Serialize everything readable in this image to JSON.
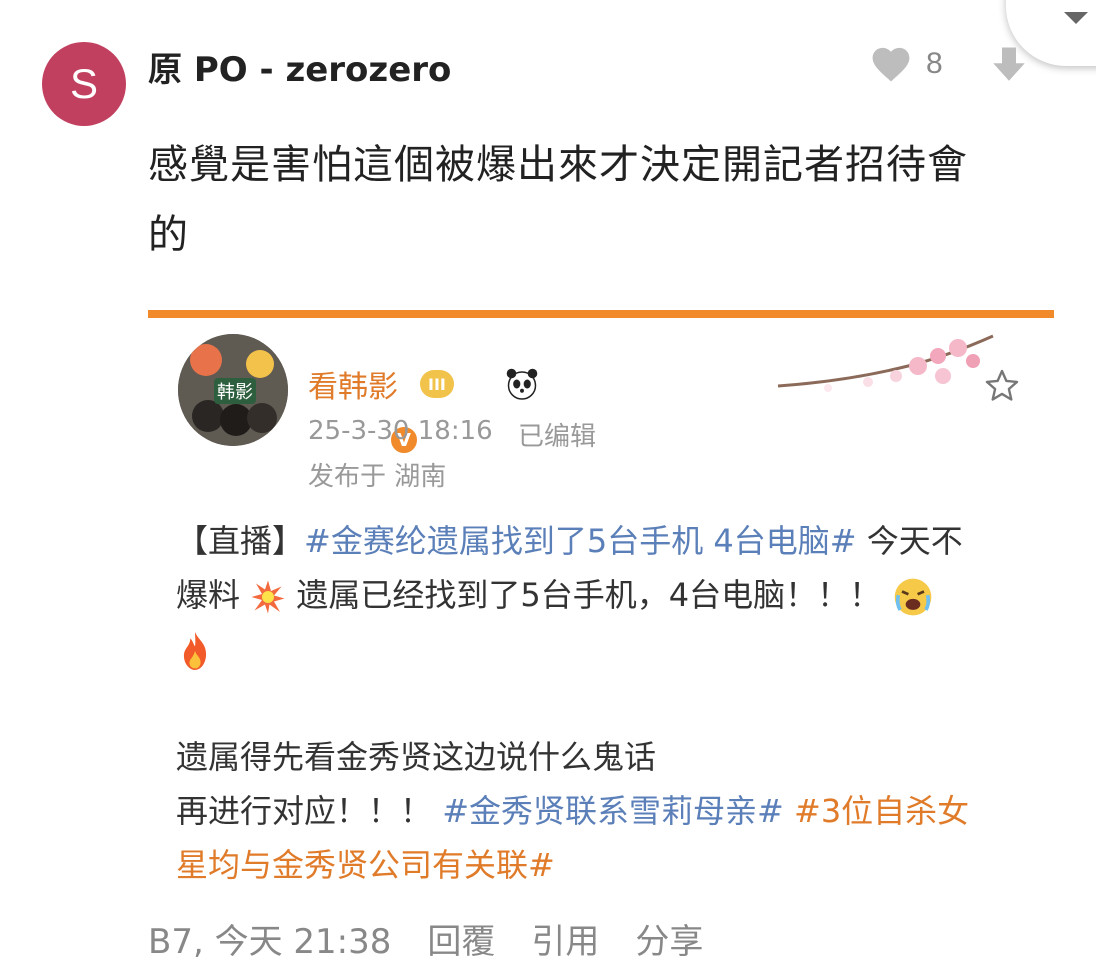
{
  "comment": {
    "avatar_letter": "S",
    "username": "原 PO - zerozero",
    "like_count": "8",
    "body_line1": "感覺是害怕這個被爆出來才決定開記者招待會",
    "body_line2": "的",
    "meta": "B7, 今天 21:38",
    "actions": {
      "reply": "回覆",
      "quote": "引用",
      "share": "分享"
    }
  },
  "embed": {
    "account_name": "看韩影",
    "avatar_badge": "韩影",
    "rank_badge": "III",
    "timestamp": "25-3-30 18:16",
    "edited": "已编辑",
    "location": "发布于 湖南",
    "p1_prefix": "【直播】",
    "p1_tag": "#金赛纶遗属找到了5台手机 4台电脑#",
    "p1_text1": " 今天不",
    "p1_text2": "爆料",
    "p1_text3": " 遗属已经找到了5台手机，4台电脑！！！",
    "p2_line1": "遗属得先看金秀贤这边说什么鬼话",
    "p2_line2_text": "再进行对应！！！",
    "p2_tag1": "#金秀贤联系雪莉母亲#",
    "p2_tag2_a": "#3位自杀女",
    "p2_tag2_b": "星均与金秀贤公司有关联#"
  },
  "colors": {
    "avatar_bg": "#c2405f",
    "accent_orange": "#f08a2a",
    "link_blue": "#5b7fb8",
    "muted_gray": "#888888"
  },
  "icons": {
    "like": "heart-icon",
    "downvote": "arrow-down-icon",
    "favorite": "star-icon",
    "dropdown": "caret-down-icon",
    "verified": "verified-v-icon",
    "panda": "panda-icon",
    "explosion": "explosion-emoji-icon",
    "crying": "crying-face-emoji-icon",
    "fire": "fire-emoji-icon"
  }
}
